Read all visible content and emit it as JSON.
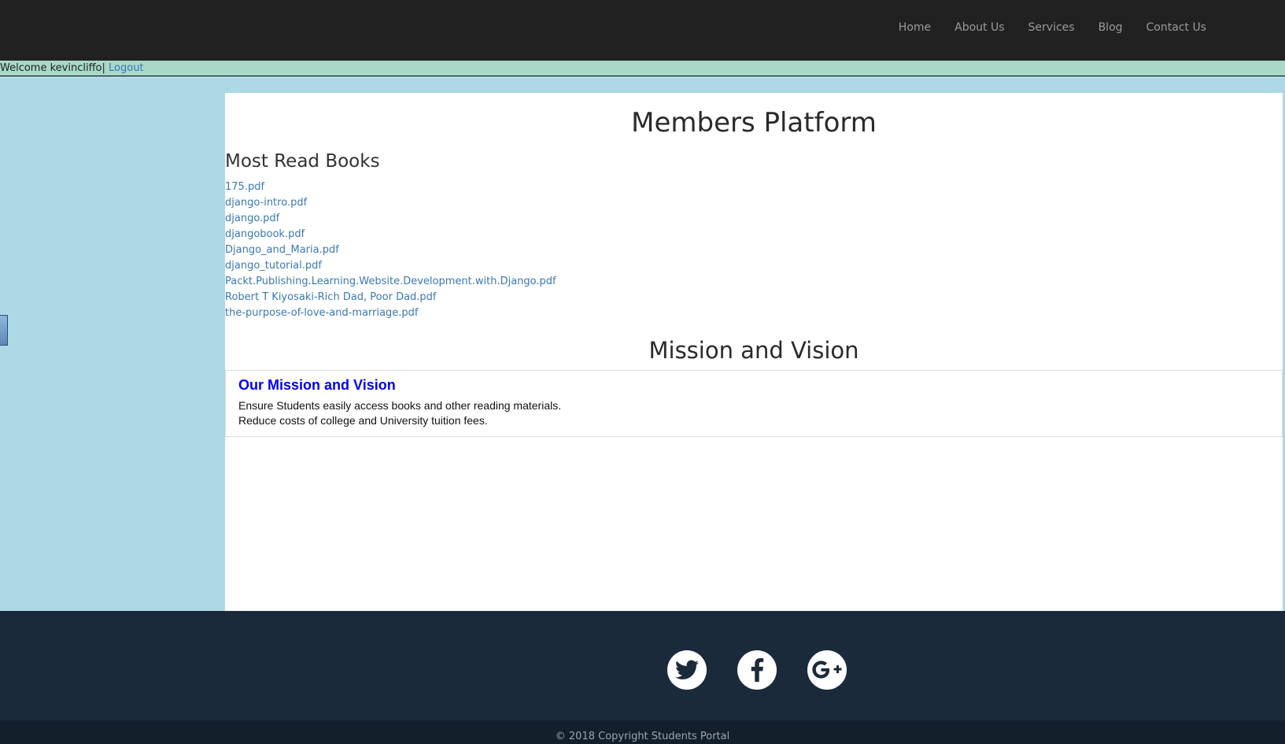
{
  "nav": {
    "items": [
      "Home",
      "About Us",
      "Services",
      "Blog",
      "Contact Us"
    ]
  },
  "welcome": {
    "text": "Welcome kevincliffo|",
    "logout_label": "Logout"
  },
  "main": {
    "title": "Members Platform",
    "books_heading": "Most Read Books",
    "books": [
      "175.pdf",
      "django-intro.pdf",
      "django.pdf",
      "djangobook.pdf",
      "Django_and_Maria.pdf",
      "django_tutorial.pdf",
      "Packt.Publishing.Learning.Website.Development.with.Django.pdf",
      "Robert T Kiyosaki-Rich Dad, Poor Dad.pdf",
      "the-purpose-of-love-and-marriage.pdf"
    ],
    "mission_heading": "Mission and Vision",
    "mission_box": {
      "title": "Our Mission and Vision",
      "lines": [
        "Ensure Students easily access books and other reading materials.",
        "Reduce costs of college and University tuition fees."
      ]
    }
  },
  "footer": {
    "social": [
      "twitter-icon",
      "facebook-icon",
      "google-plus-icon"
    ],
    "copyright": "© 2018 Copyright Students Portal"
  },
  "colors": {
    "topbar": "#212121",
    "page_bg": "#add8e6",
    "link": "#3a78b5",
    "mission_title": "#0000ee",
    "footer": "#1b2a3a"
  }
}
